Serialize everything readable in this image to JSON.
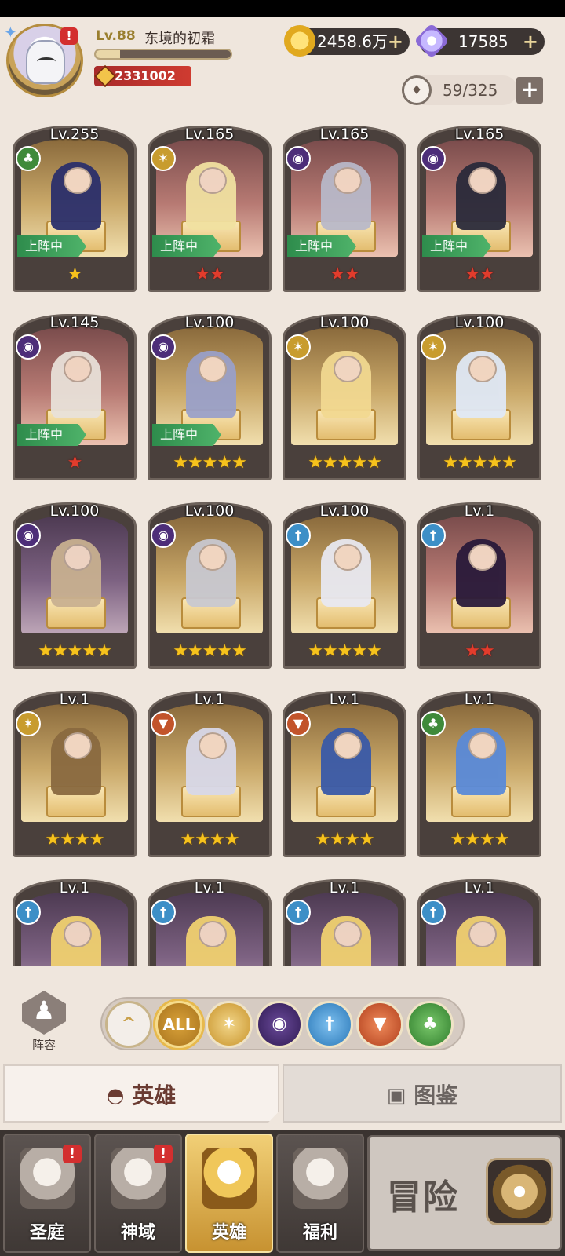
{
  "player": {
    "level": "Lv.88",
    "name": "东境的初霜",
    "exp_progress": 0.18,
    "power": "2331002",
    "alert": "!"
  },
  "currencies": {
    "gold": "2458.6万",
    "gems": "17585",
    "plus": "+"
  },
  "capacity": {
    "value": "59/325",
    "add": "+"
  },
  "deploy_label": "上阵中",
  "factions": {
    "forest": {
      "icon": "forest-tree-icon",
      "color": "#3f8a3a"
    },
    "holy": {
      "icon": "holy-star-icon",
      "color": "#c89c2e"
    },
    "dark": {
      "icon": "dark-eye-icon",
      "color": "#4d2e79"
    },
    "ice": {
      "icon": "ice-sword-icon",
      "color": "#3d8fc7"
    },
    "beast": {
      "icon": "beast-wolf-icon",
      "color": "#c2542b"
    }
  },
  "heroes": [
    {
      "level": "Lv.255",
      "faction": "forest",
      "deployed": true,
      "stars": "★",
      "star_type": "purple"
    },
    {
      "level": "Lv.165",
      "faction": "holy",
      "deployed": true,
      "stars": "★★",
      "star_type": "red"
    },
    {
      "level": "Lv.165",
      "faction": "dark",
      "deployed": true,
      "stars": "★★",
      "star_type": "red"
    },
    {
      "level": "Lv.165",
      "faction": "dark",
      "deployed": true,
      "stars": "★★",
      "star_type": "red"
    },
    {
      "level": "Lv.145",
      "faction": "dark",
      "deployed": true,
      "stars": "★",
      "star_type": "red"
    },
    {
      "level": "Lv.100",
      "faction": "dark",
      "deployed": true,
      "stars": "★★★★★",
      "star_type": "gold"
    },
    {
      "level": "Lv.100",
      "faction": "holy",
      "deployed": false,
      "stars": "★★★★★",
      "star_type": "gold"
    },
    {
      "level": "Lv.100",
      "faction": "holy",
      "deployed": false,
      "stars": "★★★★★",
      "star_type": "gold"
    },
    {
      "level": "Lv.100",
      "faction": "dark",
      "deployed": false,
      "stars": "★★★★★",
      "star_type": "gold"
    },
    {
      "level": "Lv.100",
      "faction": "dark",
      "deployed": false,
      "stars": "★★★★★",
      "star_type": "gold"
    },
    {
      "level": "Lv.100",
      "faction": "ice",
      "deployed": false,
      "stars": "★★★★★",
      "star_type": "gold"
    },
    {
      "level": "Lv.1",
      "faction": "ice",
      "deployed": false,
      "stars": "★★",
      "star_type": "red"
    },
    {
      "level": "Lv.1",
      "faction": "holy",
      "deployed": false,
      "stars": "★★★★",
      "star_type": "gold"
    },
    {
      "level": "Lv.1",
      "faction": "beast",
      "deployed": false,
      "stars": "★★★★",
      "star_type": "gold"
    },
    {
      "level": "Lv.1",
      "faction": "beast",
      "deployed": false,
      "stars": "★★★★",
      "star_type": "gold"
    },
    {
      "level": "Lv.1",
      "faction": "forest",
      "deployed": false,
      "stars": "★★★★",
      "star_type": "gold"
    },
    {
      "level": "Lv.1",
      "faction": "ice",
      "deployed": false,
      "stars": "",
      "star_type": "gold"
    },
    {
      "level": "Lv.1",
      "faction": "ice",
      "deployed": false,
      "stars": "",
      "star_type": "gold"
    },
    {
      "level": "Lv.1",
      "faction": "ice",
      "deployed": false,
      "stars": "",
      "star_type": "gold"
    },
    {
      "level": "Lv.1",
      "faction": "ice",
      "deployed": false,
      "stars": "",
      "star_type": "gold"
    }
  ],
  "team_button": {
    "label": "阵容"
  },
  "filters": {
    "all_label": "ALL"
  },
  "tabs": {
    "heroes": "英雄",
    "codex": "图鉴"
  },
  "nav": [
    {
      "label": "圣庭",
      "alert": "!"
    },
    {
      "label": "神域",
      "alert": "!"
    },
    {
      "label": "英雄",
      "alert": ""
    },
    {
      "label": "福利",
      "alert": ""
    }
  ],
  "adventure": {
    "label": "冒险"
  }
}
